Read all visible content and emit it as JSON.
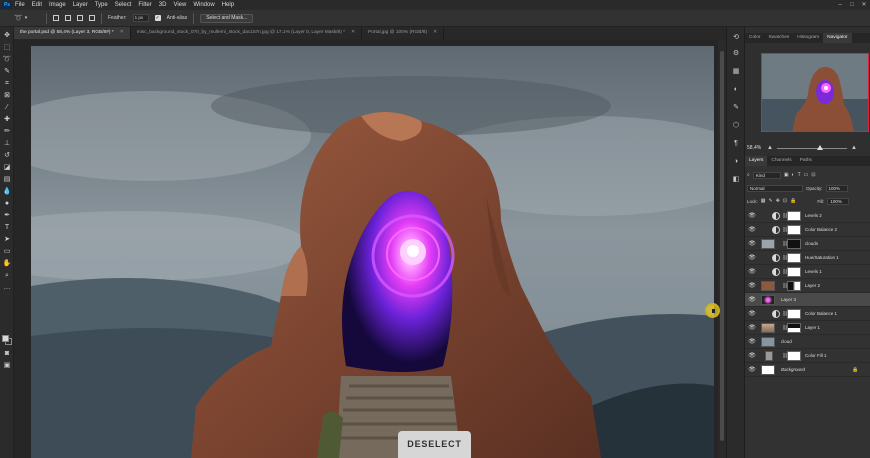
{
  "app": {
    "logo": "Ps"
  },
  "menu": [
    "File",
    "Edit",
    "Image",
    "Layer",
    "Type",
    "Select",
    "Filter",
    "3D",
    "View",
    "Window",
    "Help"
  ],
  "window_controls": {
    "minimize": "–",
    "maximize": "□",
    "close": "✕"
  },
  "options": {
    "feather_label": "Feather:",
    "feather_value": "1 px",
    "antialias_label": "Anti-alias",
    "antialias_checked": true,
    "select_mask_label": "Select and Mask..."
  },
  "doc_tabs": [
    {
      "label": "the portal.psd @ 58,4% (Layer 3, RGB/8#) *",
      "active": true
    },
    {
      "label": "misc_background_stock_070_by_mullerni_stock_dac157n.jpg @ 17,1% (Layer 0, Layer Mask/8) *",
      "active": false
    },
    {
      "label": "Portal.jpg @ 100% (RGB/8)",
      "active": false
    }
  ],
  "canvas": {
    "deselect_label": "DESELECT"
  },
  "panel_tabs_top": [
    "Color",
    "Swatches",
    "Histogram",
    "Navigator"
  ],
  "navigator": {
    "zoom": "58,4%"
  },
  "panel_tabs_layers": [
    "Layers",
    "Channels",
    "Paths"
  ],
  "layers_controls": {
    "filter_kind": "Kind",
    "blend_mode": "Normal",
    "opacity_label": "Opacity:",
    "opacity_value": "100%",
    "lock_label": "Lock:",
    "fill_label": "Fill:",
    "fill_value": "100%"
  },
  "layers": [
    {
      "name": "Levels 2",
      "type": "adjustment"
    },
    {
      "name": "Color Balance 2",
      "type": "adjustment"
    },
    {
      "name": "clouds",
      "type": "pixel"
    },
    {
      "name": "Hue/Saturation 1",
      "type": "adjustment"
    },
    {
      "name": "Levels 1",
      "type": "adjustment"
    },
    {
      "name": "Layer 2",
      "type": "pixel"
    },
    {
      "name": "Layer 3",
      "type": "pixel",
      "selected": true
    },
    {
      "name": "Color Balance 1",
      "type": "adjustment"
    },
    {
      "name": "Layer 1",
      "type": "pixel"
    },
    {
      "name": "cloud",
      "type": "pixel"
    },
    {
      "name": "Color Fill 1",
      "type": "fill"
    },
    {
      "name": "Background",
      "type": "background",
      "locked": true
    }
  ],
  "colors": {
    "ui_bg": "#2f2f2f",
    "selected_layer": "#4a4a4a",
    "navigator_frame": "#dd2233",
    "portal_magenta": "#ff3cff",
    "rock": "#8a4f36",
    "sky": "#6f7d86"
  }
}
